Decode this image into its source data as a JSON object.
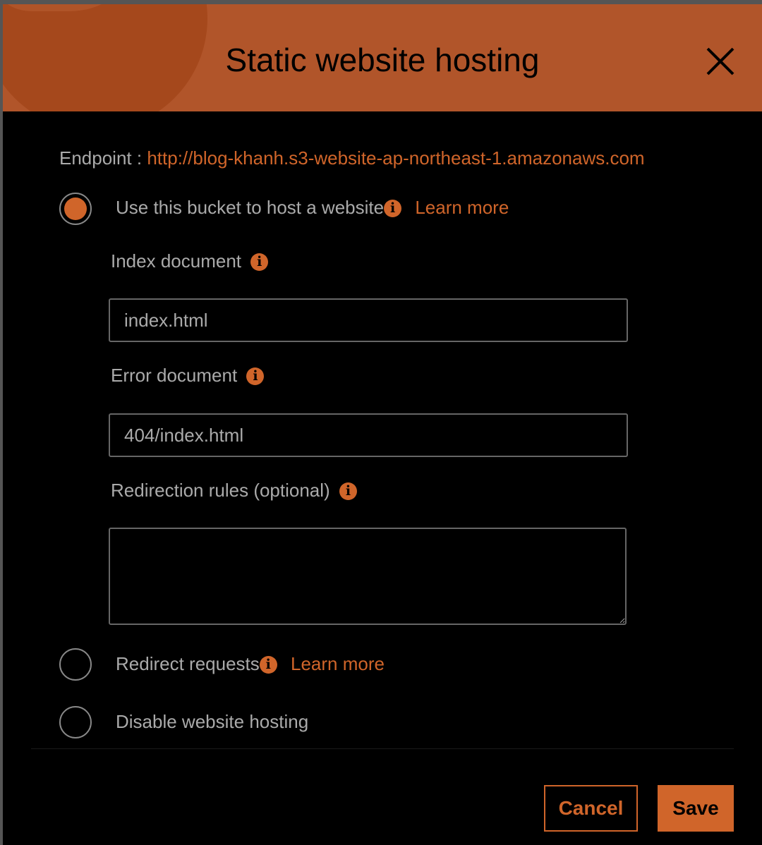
{
  "dialog": {
    "title": "Static website hosting"
  },
  "endpoint": {
    "label": "Endpoint :",
    "url": "http://blog-khanh.s3-website-ap-northeast-1.amazonaws.com"
  },
  "options": [
    {
      "label": "Use this bucket to host a website",
      "learn_more": "Learn more",
      "selected": true
    },
    {
      "label": "Redirect requests",
      "learn_more": "Learn more",
      "selected": false
    },
    {
      "label": "Disable website hosting",
      "selected": false
    }
  ],
  "fields": {
    "index": {
      "label": "Index document",
      "value": "index.html"
    },
    "error": {
      "label": "Error document",
      "value": "404/index.html"
    },
    "redirect": {
      "label": "Redirection rules (optional)",
      "value": ""
    }
  },
  "info_glyph": "i",
  "buttons": {
    "cancel": "Cancel",
    "save": "Save"
  },
  "colors": {
    "accent": "#d0652a",
    "header": "#b1552a"
  }
}
